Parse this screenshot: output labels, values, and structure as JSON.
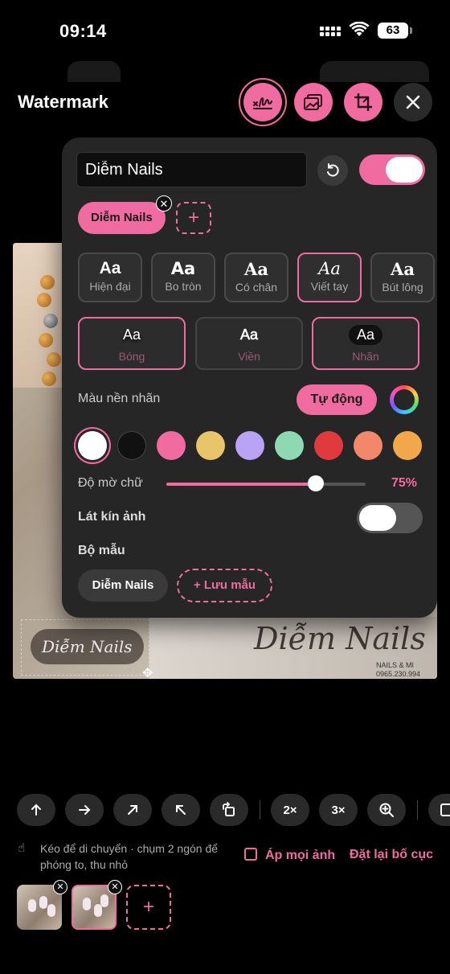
{
  "status": {
    "time": "09:14",
    "battery": "63"
  },
  "header": {
    "title": "Watermark"
  },
  "panel": {
    "text_value": "Diễm Nails",
    "preset_chip": "Diễm Nails",
    "fonts": [
      {
        "aa": "Aa",
        "label": "Hiện đại"
      },
      {
        "aa": "Aa",
        "label": "Bo tròn"
      },
      {
        "aa": "Aa",
        "label": "Có chân"
      },
      {
        "aa": "Aa",
        "label": "Viết tay"
      },
      {
        "aa": "Aa",
        "label": "Bút lông"
      }
    ],
    "styles": [
      {
        "aa": "Aa",
        "label": "Bóng"
      },
      {
        "aa": "Aa",
        "label": "Viền"
      },
      {
        "aa": "Aa",
        "label": "Nhãn"
      }
    ],
    "bg_color_label": "Màu nền nhãn",
    "auto_label": "Tự động",
    "swatches": [
      "#ffffff",
      "#111111",
      "#f06b9f",
      "#e8c46a",
      "#b9a3f5",
      "#8fd8b4",
      "#e0393e",
      "#f2876a",
      "#f2a84a"
    ],
    "opacity_label": "Độ mờ chữ",
    "opacity_value": "75%",
    "opacity": 0.75,
    "tile_label": "Lát kín ảnh",
    "templates_label": "Bộ mẫu",
    "template_chip": "Diễm Nails",
    "save_template": "+ Lưu mẫu"
  },
  "photo": {
    "watermark_text": "Diễm Nails",
    "script_text": "Diễm Nails",
    "small_lines": [
      "NAILS & MI",
      "0965.230.994"
    ]
  },
  "toolbar": {
    "zoom2": "2×",
    "zoom3": "3×"
  },
  "hint": "Kéo để di chuyển · chụm 2 ngón để phóng to, thu nhỏ",
  "apply_all": "Áp mọi ảnh",
  "reset_layout": "Đặt lại bố cục",
  "accent": "#f06b9f"
}
